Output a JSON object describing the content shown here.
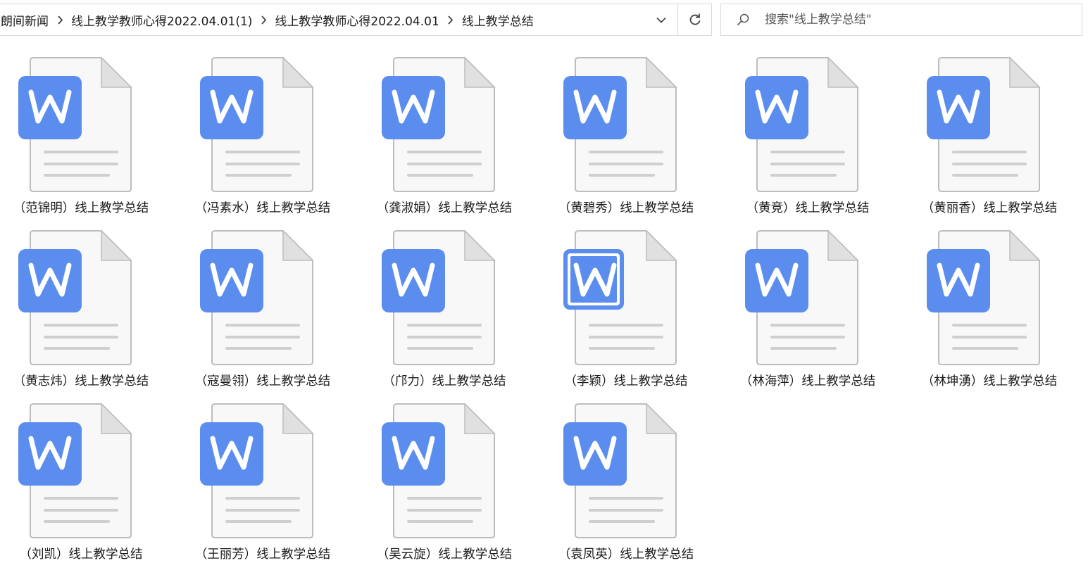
{
  "address_bar": {
    "breadcrumbs": [
      "朗间新闻",
      "线上教学教师心得2022.04.01(1)",
      "线上教学教师心得2022.04.01",
      "线上教学总结"
    ]
  },
  "search": {
    "placeholder": "搜索\"线上教学总结\""
  },
  "icons": {
    "file": "word-document-icon",
    "search": "search-icon",
    "refresh": "refresh-icon",
    "dropdown": "chevron-down-icon",
    "separator": "chevron-right-icon"
  },
  "colors": {
    "word_blue": "#5b8def",
    "page_fill": "#f8f8f8",
    "page_border": "#bdbdbd",
    "page_lines": "#cfcfcf"
  },
  "files": [
    {
      "name": "（范锦明）线上教学总结"
    },
    {
      "name": "（冯素水）线上教学总结"
    },
    {
      "name": "（龚淑娟）线上教学总结"
    },
    {
      "name": "（黄碧秀）线上教学总结"
    },
    {
      "name": "（黄竞）线上教学总结"
    },
    {
      "name": "（黄丽香）线上教学总结"
    },
    {
      "name": "（黄志炜）线上教学总结"
    },
    {
      "name": "（寇曼翎）线上教学总结"
    },
    {
      "name": "（邝力）线上教学总结"
    },
    {
      "name": "（李颖）线上教学总结",
      "focused": true
    },
    {
      "name": "（林海萍）线上教学总结"
    },
    {
      "name": "（林坤湧）线上教学总结"
    },
    {
      "name": "（刘凯）线上教学总结"
    },
    {
      "name": "（王丽芳）线上教学总结"
    },
    {
      "name": "（吴云旋）线上教学总结"
    },
    {
      "name": "（袁凤英）线上教学总结"
    }
  ]
}
